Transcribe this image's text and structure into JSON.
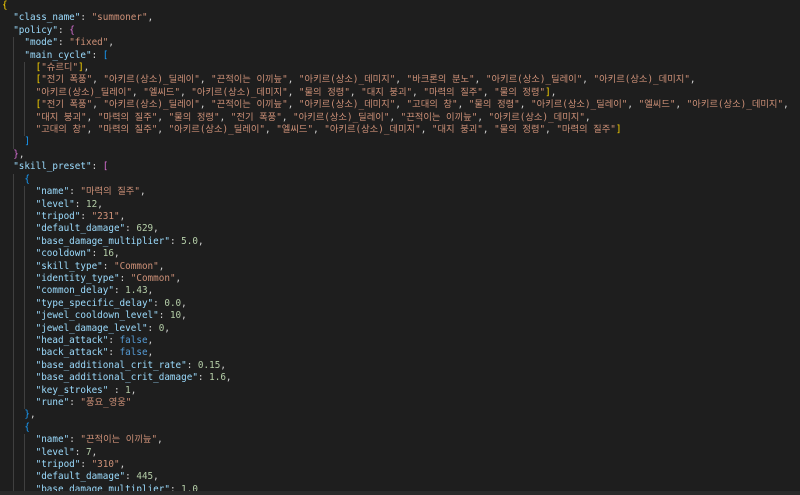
{
  "lines": [
    [
      [
        "{",
        "br1"
      ]
    ],
    [
      [
        "  ",
        ""
      ],
      [
        "\"class_name\"",
        "k"
      ],
      [
        ": ",
        "p"
      ],
      [
        "\"summoner\"",
        "s"
      ],
      [
        ",",
        "p"
      ]
    ],
    [
      [
        "  ",
        ""
      ],
      [
        "\"policy\"",
        "k"
      ],
      [
        ": ",
        "p"
      ],
      [
        "{",
        "br2"
      ]
    ],
    [
      [
        "    ",
        ""
      ],
      [
        "\"mode\"",
        "k"
      ],
      [
        ": ",
        "p"
      ],
      [
        "\"fixed\"",
        "s"
      ],
      [
        ",",
        "p"
      ]
    ],
    [
      [
        "    ",
        ""
      ],
      [
        "\"main_cycle\"",
        "k"
      ],
      [
        ": ",
        "p"
      ],
      [
        "[",
        "br3"
      ]
    ],
    [
      [
        "      ",
        ""
      ],
      [
        "[",
        "br1"
      ],
      [
        "\"슈르디\"",
        "s"
      ],
      [
        "]",
        "br1"
      ],
      [
        ",",
        "p"
      ]
    ],
    [
      [
        "      ",
        ""
      ],
      [
        "[",
        "br1"
      ],
      [
        "\"전기 폭풍\"",
        "s"
      ],
      [
        ", ",
        "p"
      ],
      [
        "\"아키르(상소)_딜레이\"",
        "s"
      ],
      [
        ", ",
        "p"
      ],
      [
        "\"끈적이는 이끼늪\"",
        "s"
      ],
      [
        ", ",
        "p"
      ],
      [
        "\"아키르(상소)_데미지\"",
        "s"
      ],
      [
        ", ",
        "p"
      ],
      [
        "\"바크론의 분노\"",
        "s"
      ],
      [
        ", ",
        "p"
      ],
      [
        "\"아키르(상소)_딜레이\"",
        "s"
      ],
      [
        ", ",
        "p"
      ],
      [
        "\"아키르(상소)_데미지\"",
        "s"
      ],
      [
        ",",
        "p"
      ]
    ],
    [
      [
        "      ",
        ""
      ],
      [
        "\"아키르(상소)_딜레이\"",
        "s"
      ],
      [
        ", ",
        "p"
      ],
      [
        "\"엘씨드\"",
        "s"
      ],
      [
        ", ",
        "p"
      ],
      [
        "\"아키르(상소)_데미지\"",
        "s"
      ],
      [
        ", ",
        "p"
      ],
      [
        "\"물의 정령\"",
        "s"
      ],
      [
        ", ",
        "p"
      ],
      [
        "\"대지 붕괴\"",
        "s"
      ],
      [
        ", ",
        "p"
      ],
      [
        "\"마력의 질주\"",
        "s"
      ],
      [
        ", ",
        "p"
      ],
      [
        "\"물의 정령\"",
        "s"
      ],
      [
        "]",
        "br1"
      ],
      [
        ",",
        "p"
      ]
    ],
    [
      [
        "      ",
        ""
      ],
      [
        "[",
        "br1"
      ],
      [
        "\"전기 폭풍\"",
        "s"
      ],
      [
        ", ",
        "p"
      ],
      [
        "\"아키르(상소)_딜레이\"",
        "s"
      ],
      [
        ", ",
        "p"
      ],
      [
        "\"끈적이는 이끼늪\"",
        "s"
      ],
      [
        ", ",
        "p"
      ],
      [
        "\"아키르(상소)_데미지\"",
        "s"
      ],
      [
        ", ",
        "p"
      ],
      [
        "\"고대의 창\"",
        "s"
      ],
      [
        ", ",
        "p"
      ],
      [
        "\"물의 정령\"",
        "s"
      ],
      [
        ", ",
        "p"
      ],
      [
        "\"아키르(상소)_딜레이\"",
        "s"
      ],
      [
        ", ",
        "p"
      ],
      [
        "\"엘씨드\"",
        "s"
      ],
      [
        ", ",
        "p"
      ],
      [
        "\"아키르(상소)_데미지\"",
        "s"
      ],
      [
        ",",
        "p"
      ]
    ],
    [
      [
        "      ",
        ""
      ],
      [
        "\"대지 붕괴\"",
        "s"
      ],
      [
        ", ",
        "p"
      ],
      [
        "\"마력의 질주\"",
        "s"
      ],
      [
        ", ",
        "p"
      ],
      [
        "\"물의 정령\"",
        "s"
      ],
      [
        ", ",
        "p"
      ],
      [
        "\"전기 폭풍\"",
        "s"
      ],
      [
        ", ",
        "p"
      ],
      [
        "\"아키르(상소)_딜레이\"",
        "s"
      ],
      [
        ", ",
        "p"
      ],
      [
        "\"끈적이는 이끼늪\"",
        "s"
      ],
      [
        ", ",
        "p"
      ],
      [
        "\"아키르(상소)_데미지\"",
        "s"
      ],
      [
        ",",
        "p"
      ]
    ],
    [
      [
        "      ",
        ""
      ],
      [
        "\"고대의 창\"",
        "s"
      ],
      [
        ", ",
        "p"
      ],
      [
        "\"마력의 질주\"",
        "s"
      ],
      [
        ", ",
        "p"
      ],
      [
        "\"아키르(상소)_딜레이\"",
        "s"
      ],
      [
        ", ",
        "p"
      ],
      [
        "\"엘씨드\"",
        "s"
      ],
      [
        ", ",
        "p"
      ],
      [
        "\"아키르(상소)_데미지\"",
        "s"
      ],
      [
        ", ",
        "p"
      ],
      [
        "\"대지 붕괴\"",
        "s"
      ],
      [
        ", ",
        "p"
      ],
      [
        "\"물의 정령\"",
        "s"
      ],
      [
        ", ",
        "p"
      ],
      [
        "\"마력의 질주\"",
        "s"
      ],
      [
        "]",
        "br1"
      ]
    ],
    [
      [
        "    ",
        ""
      ],
      [
        "]",
        "br3"
      ]
    ],
    [
      [
        "  ",
        ""
      ],
      [
        "}",
        "br2"
      ],
      [
        ",",
        "p"
      ]
    ],
    [
      [
        "  ",
        ""
      ],
      [
        "\"skill_preset\"",
        "k"
      ],
      [
        ": ",
        "p"
      ],
      [
        "[",
        "br2"
      ]
    ],
    [
      [
        "    ",
        ""
      ],
      [
        "{",
        "br3"
      ]
    ],
    [
      [
        "      ",
        ""
      ],
      [
        "\"name\"",
        "k"
      ],
      [
        ": ",
        "p"
      ],
      [
        "\"마력의 질주\"",
        "s"
      ],
      [
        ",",
        "p"
      ]
    ],
    [
      [
        "      ",
        ""
      ],
      [
        "\"level\"",
        "k"
      ],
      [
        ": ",
        "p"
      ],
      [
        "12",
        "n"
      ],
      [
        ",",
        "p"
      ]
    ],
    [
      [
        "      ",
        ""
      ],
      [
        "\"tripod\"",
        "k"
      ],
      [
        ": ",
        "p"
      ],
      [
        "\"231\"",
        "s"
      ],
      [
        ",",
        "p"
      ]
    ],
    [
      [
        "      ",
        ""
      ],
      [
        "\"default_damage\"",
        "k"
      ],
      [
        ": ",
        "p"
      ],
      [
        "629",
        "n"
      ],
      [
        ",",
        "p"
      ]
    ],
    [
      [
        "      ",
        ""
      ],
      [
        "\"base_damage_multiplier\"",
        "k"
      ],
      [
        ": ",
        "p"
      ],
      [
        "5.0",
        "n"
      ],
      [
        ",",
        "p"
      ]
    ],
    [
      [
        "      ",
        ""
      ],
      [
        "\"cooldown\"",
        "k"
      ],
      [
        ": ",
        "p"
      ],
      [
        "16",
        "n"
      ],
      [
        ",",
        "p"
      ]
    ],
    [
      [
        "      ",
        ""
      ],
      [
        "\"skill_type\"",
        "k"
      ],
      [
        ": ",
        "p"
      ],
      [
        "\"Common\"",
        "s"
      ],
      [
        ",",
        "p"
      ]
    ],
    [
      [
        "      ",
        ""
      ],
      [
        "\"identity_type\"",
        "k"
      ],
      [
        ": ",
        "p"
      ],
      [
        "\"Common\"",
        "s"
      ],
      [
        ",",
        "p"
      ]
    ],
    [
      [
        "      ",
        ""
      ],
      [
        "\"common_delay\"",
        "k"
      ],
      [
        ": ",
        "p"
      ],
      [
        "1.43",
        "n"
      ],
      [
        ",",
        "p"
      ]
    ],
    [
      [
        "      ",
        ""
      ],
      [
        "\"type_specific_delay\"",
        "k"
      ],
      [
        ": ",
        "p"
      ],
      [
        "0.0",
        "n"
      ],
      [
        ",",
        "p"
      ]
    ],
    [
      [
        "      ",
        ""
      ],
      [
        "\"jewel_cooldown_level\"",
        "k"
      ],
      [
        ": ",
        "p"
      ],
      [
        "10",
        "n"
      ],
      [
        ",",
        "p"
      ]
    ],
    [
      [
        "      ",
        ""
      ],
      [
        "\"jewel_damage_level\"",
        "k"
      ],
      [
        ": ",
        "p"
      ],
      [
        "0",
        "n"
      ],
      [
        ",",
        "p"
      ]
    ],
    [
      [
        "      ",
        ""
      ],
      [
        "\"head_attack\"",
        "k"
      ],
      [
        ": ",
        "p"
      ],
      [
        "false",
        "b"
      ],
      [
        ",",
        "p"
      ]
    ],
    [
      [
        "      ",
        ""
      ],
      [
        "\"back_attack\"",
        "k"
      ],
      [
        ": ",
        "p"
      ],
      [
        "false",
        "b"
      ],
      [
        ",",
        "p"
      ]
    ],
    [
      [
        "      ",
        ""
      ],
      [
        "\"base_additional_crit_rate\"",
        "k"
      ],
      [
        ": ",
        "p"
      ],
      [
        "0.15",
        "n"
      ],
      [
        ",",
        "p"
      ]
    ],
    [
      [
        "      ",
        ""
      ],
      [
        "\"base_additional_crit_damage\"",
        "k"
      ],
      [
        ": ",
        "p"
      ],
      [
        "1.6",
        "n"
      ],
      [
        ",",
        "p"
      ]
    ],
    [
      [
        "      ",
        ""
      ],
      [
        "\"key_strokes\"",
        "k"
      ],
      [
        " : ",
        "p"
      ],
      [
        "1",
        "n"
      ],
      [
        ",",
        "p"
      ]
    ],
    [
      [
        "      ",
        ""
      ],
      [
        "\"rune\"",
        "k"
      ],
      [
        ": ",
        "p"
      ],
      [
        "\"풍요_영웅\"",
        "s"
      ]
    ],
    [
      [
        "    ",
        ""
      ],
      [
        "}",
        "br3"
      ],
      [
        ",",
        "p"
      ]
    ],
    [
      [
        "    ",
        ""
      ],
      [
        "{",
        "br3"
      ]
    ],
    [
      [
        "      ",
        ""
      ],
      [
        "\"name\"",
        "k"
      ],
      [
        ": ",
        "p"
      ],
      [
        "\"끈적이는 이끼늪\"",
        "s"
      ],
      [
        ",",
        "p"
      ]
    ],
    [
      [
        "      ",
        ""
      ],
      [
        "\"level\"",
        "k"
      ],
      [
        ": ",
        "p"
      ],
      [
        "7",
        "n"
      ],
      [
        ",",
        "p"
      ]
    ],
    [
      [
        "      ",
        ""
      ],
      [
        "\"tripod\"",
        "k"
      ],
      [
        ": ",
        "p"
      ],
      [
        "\"310\"",
        "s"
      ],
      [
        ",",
        "p"
      ]
    ],
    [
      [
        "      ",
        ""
      ],
      [
        "\"default_damage\"",
        "k"
      ],
      [
        ": ",
        "p"
      ],
      [
        "445",
        "n"
      ],
      [
        ",",
        "p"
      ]
    ],
    [
      [
        "      ",
        ""
      ],
      [
        "\"base_damage_multiplier\"",
        "k"
      ],
      [
        ": ",
        "p"
      ],
      [
        "1.0",
        "n"
      ]
    ]
  ]
}
